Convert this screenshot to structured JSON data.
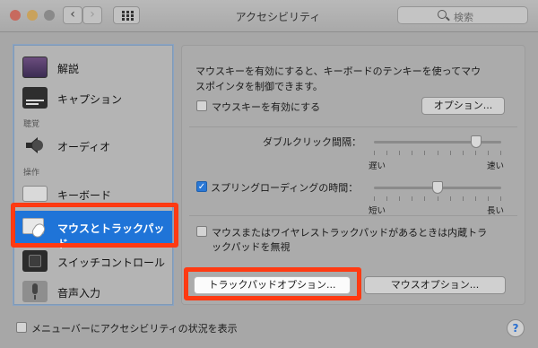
{
  "window": {
    "title": "アクセシビリティ"
  },
  "toolbar": {
    "back": "‹",
    "forward": "›",
    "search_placeholder": "検索"
  },
  "sidebar": {
    "items": [
      {
        "label": "解説",
        "icon": "display-icon"
      },
      {
        "label": "キャプション",
        "icon": "caption-icon"
      },
      {
        "label": "オーディオ",
        "icon": "speaker-icon"
      },
      {
        "label": "キーボード",
        "icon": "keyboard-icon"
      },
      {
        "label": "マウスとトラックパッド",
        "icon": "mouse-trackpad-icon",
        "selected": true
      },
      {
        "label": "スイッチコントロール",
        "icon": "switch-control-icon"
      },
      {
        "label": "音声入力",
        "icon": "microphone-icon"
      }
    ],
    "categories": {
      "hearing": "聴覚",
      "interaction": "操作"
    }
  },
  "main": {
    "description": "マウスキーを有効にすると、キーボードのテンキーを使ってマウスポインタを制御できます。",
    "description_line1": "マウスキーを有効にすると、キーボードのテンキーを使ってマウ",
    "description_line2": "スポインタを制御できます。",
    "mousekeys_checkbox": {
      "label": "マウスキーを有効にする",
      "checked": false
    },
    "options_button": "オプション...",
    "double_click": {
      "label": "ダブルクリック間隔：",
      "min": "遅い",
      "max": "速い",
      "value": 0.8
    },
    "spring_loading": {
      "label": "スプリングローディングの時間：",
      "checked": true,
      "min": "短い",
      "max": "長い",
      "value": 0.5
    },
    "ignore_trackpad": {
      "line1": "マウスまたはワイヤレストラックパッドがあるときは内蔵トラ",
      "line2": "ックパッドを無視",
      "checked": false
    },
    "trackpad_options_button": "トラックパッドオプション...",
    "mouse_options_button": "マウスオプション..."
  },
  "footer": {
    "menubar_checkbox": "メニューバーにアクセシビリティの状況を表示",
    "checked": false,
    "help": "?"
  },
  "colors": {
    "selection": "#1f74d8",
    "highlight": "#ff3a12",
    "checkbox_checked": "#2a78d6"
  }
}
